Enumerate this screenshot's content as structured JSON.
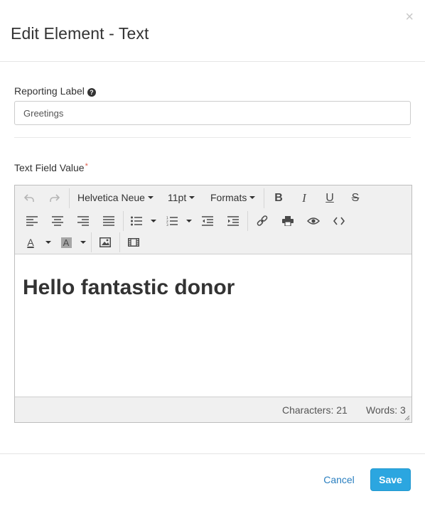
{
  "modal": {
    "title": "Edit Element - Text",
    "close_glyph": "×"
  },
  "reporting_label": {
    "label": "Reporting Label",
    "help_icon": "question-circle-icon",
    "value": "Greetings"
  },
  "text_field": {
    "label": "Text Field Value",
    "required_marker": "*"
  },
  "toolbar": {
    "font_family": "Helvetica Neue",
    "font_size": "11pt",
    "formats": "Formats",
    "bold": "B",
    "italic": "I",
    "underline": "U",
    "strikethrough": "S",
    "text_color_glyph": "A",
    "bg_color_glyph": "A",
    "icons": [
      "undo-icon",
      "redo-icon",
      "bold-icon",
      "italic-icon",
      "underline-icon",
      "strikethrough-icon",
      "align-left-icon",
      "align-center-icon",
      "align-right-icon",
      "align-justify-icon",
      "bullet-list-icon",
      "numbered-list-icon",
      "outdent-icon",
      "indent-icon",
      "link-icon",
      "print-icon",
      "preview-icon",
      "source-code-icon",
      "text-color-icon",
      "background-color-icon",
      "image-icon",
      "media-icon"
    ]
  },
  "editor": {
    "content": "Hello fantastic donor",
    "characters": "Characters: 21",
    "words": "Words: 3"
  },
  "footer": {
    "cancel_label": "Cancel",
    "save_label": "Save"
  },
  "colors": {
    "save_button": "#2ba6e0",
    "link": "#2a7fc0",
    "required": "#e05a4a",
    "toolbar_bg": "#f0f0f0"
  }
}
